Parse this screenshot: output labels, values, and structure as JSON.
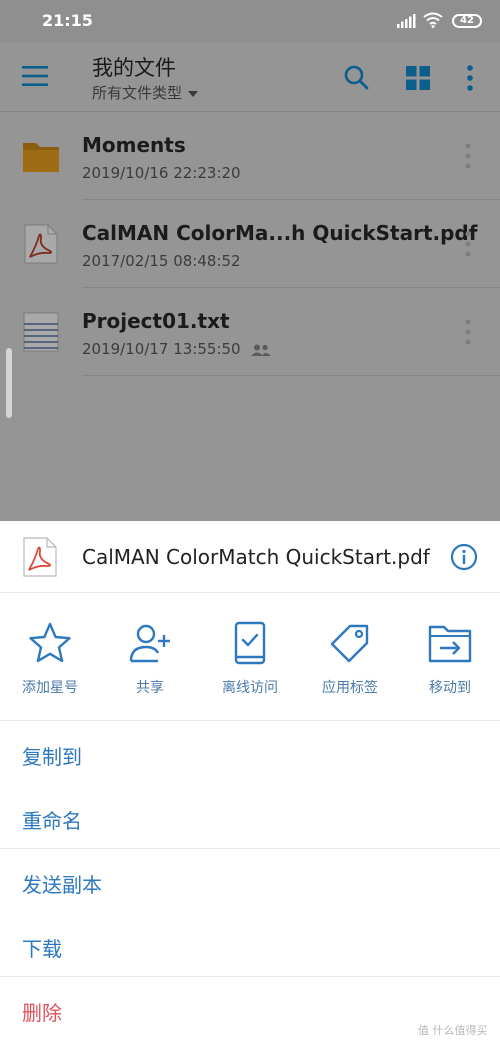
{
  "status_bar": {
    "time": "21:15",
    "battery": "42",
    "icons": [
      "signal-icon",
      "wifi-icon",
      "battery-icon"
    ]
  },
  "app_bar": {
    "title": "我的文件",
    "subtitle": "所有文件类型",
    "icons": [
      "menu-icon",
      "search-icon",
      "grid-view-icon",
      "more-vert-icon"
    ]
  },
  "files": [
    {
      "name": "Moments",
      "date": "2019/10/16 22:23:20",
      "icon": "folder-icon",
      "shared": false
    },
    {
      "name": "CalMAN ColorMa...h QuickStart.pdf",
      "date": "2017/02/15 08:48:52",
      "icon": "pdf-icon",
      "shared": false
    },
    {
      "name": "Project01.txt",
      "date": "2019/10/17 13:55:50",
      "icon": "text-file-icon",
      "shared": true
    }
  ],
  "sheet": {
    "file_name": "CalMAN ColorMatch QuickStart.pdf",
    "file_icon": "pdf-icon",
    "actions": [
      {
        "label": "添加星号",
        "icon": "star-icon"
      },
      {
        "label": "共享",
        "icon": "add-person-icon"
      },
      {
        "label": "离线访问",
        "icon": "offline-device-icon"
      },
      {
        "label": "应用标签",
        "icon": "tag-icon"
      },
      {
        "label": "移动到",
        "icon": "move-folder-icon"
      }
    ],
    "menu": [
      {
        "label": "复制到"
      },
      {
        "label": "重命名"
      },
      {
        "label": "发送副本"
      },
      {
        "label": "下载"
      },
      {
        "label": "删除"
      }
    ]
  },
  "colors": {
    "accent": "#2e78c0",
    "danger": "#e0525a",
    "folder": "#e8a21a",
    "pdf_red": "#d94a3a"
  },
  "watermark": "值 什么值得买"
}
